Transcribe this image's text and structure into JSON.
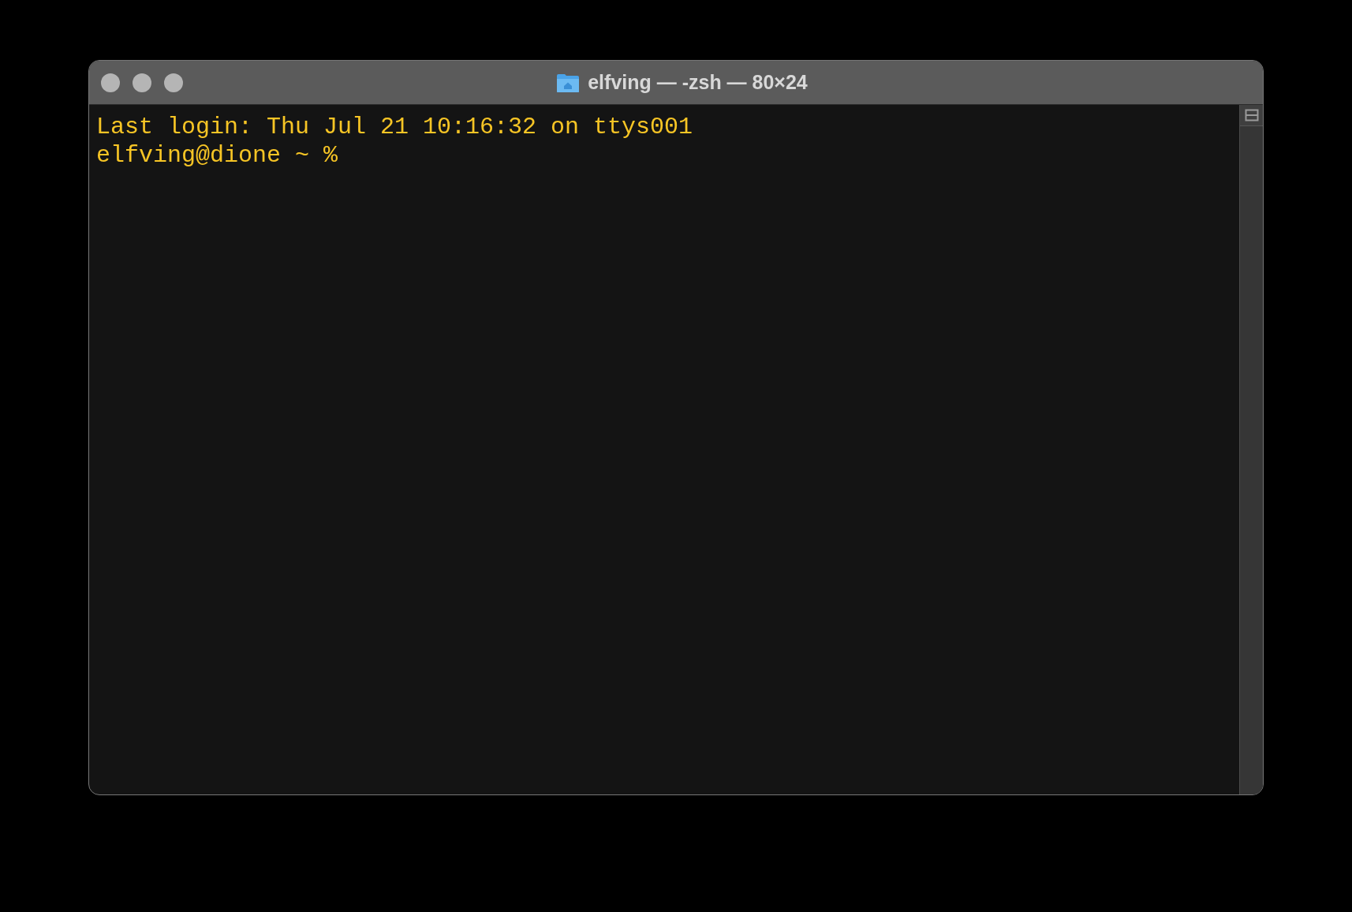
{
  "window": {
    "title": "elfving — -zsh — 80×24"
  },
  "terminal": {
    "lines": [
      "Last login: Thu Jul 21 10:16:32 on ttys001",
      "elfving@dione ~ %"
    ]
  }
}
